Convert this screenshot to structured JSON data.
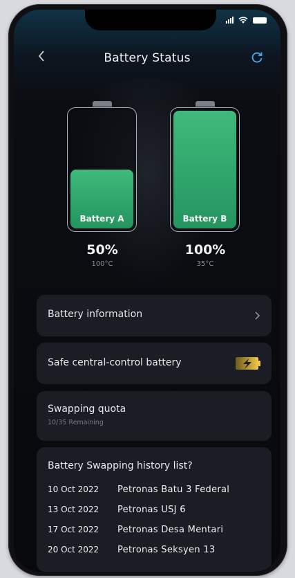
{
  "header": {
    "title": "Battery Status"
  },
  "icons": {
    "back": "chevron-left-icon",
    "refresh": "refresh-icon",
    "arrow": "chevron-right-icon",
    "bolt": "bolt-battery-icon"
  },
  "batteries": [
    {
      "name": "Battery A",
      "percent": "50%",
      "level": 0.5,
      "temp": "100°C"
    },
    {
      "name": "Battery B",
      "percent": "100%",
      "level": 1.0,
      "temp": "35°C"
    }
  ],
  "cards": {
    "info": "Battery information",
    "safe": "Safe central-control battery",
    "quota": {
      "title": "Swapping quota",
      "sub": "10/35 Remaining"
    }
  },
  "history": {
    "title": "Battery Swapping history list?",
    "rows": [
      {
        "date": "10 Oct 2022",
        "location": "Petronas Batu 3 Federal"
      },
      {
        "date": "13 Oct 2022",
        "location": "Petronas USJ 6"
      },
      {
        "date": "17 Oct 2022",
        "location": "Petronas Desa Mentari"
      },
      {
        "date": "20 Oct 2022",
        "location": "Petronas Seksyen 13"
      }
    ]
  },
  "colors": {
    "accent": "#4aa8e8",
    "battery_fill": "#2fa66b",
    "card_bg": "#1a1d24"
  }
}
